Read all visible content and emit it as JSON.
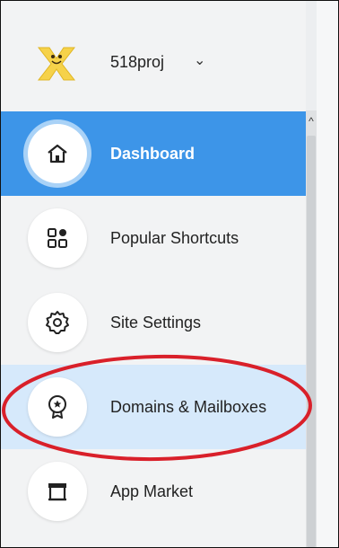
{
  "header": {
    "site_name": "518proj",
    "chevron": "⌄",
    "logo_icon": "wix-logo"
  },
  "nav": {
    "items": [
      {
        "label": "Dashboard",
        "icon": "home-icon",
        "state": "active"
      },
      {
        "label": "Popular Shortcuts",
        "icon": "grid-icon",
        "state": "normal"
      },
      {
        "label": "Site Settings",
        "icon": "gear-icon",
        "state": "normal"
      },
      {
        "label": "Domains & Mailboxes",
        "icon": "badge-star-icon",
        "state": "hover"
      },
      {
        "label": "App Market",
        "icon": "store-icon",
        "state": "normal"
      }
    ]
  },
  "scrollbar": {
    "up_arrow": "^"
  },
  "colors": {
    "active_bg": "#3d95e8",
    "hover_bg": "#d6e9fb",
    "annotation": "#d9202a"
  }
}
